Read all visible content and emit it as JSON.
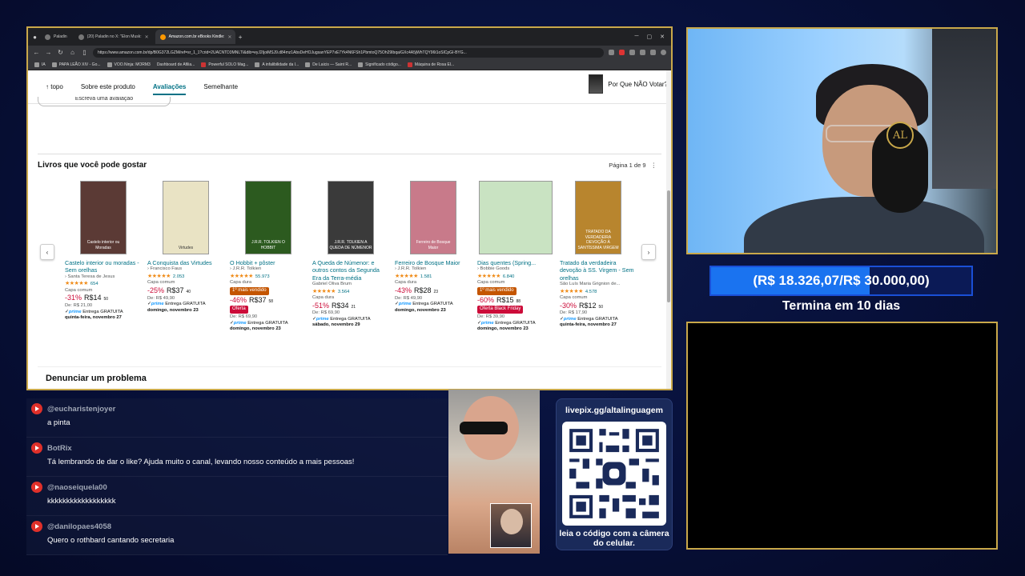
{
  "browser": {
    "tabs": [
      {
        "label": "Paladin"
      },
      {
        "label": "(20) Paladin no X: \"Elon Musk:"
      },
      {
        "label": "Amazon.com.br eBooks Kindle:"
      }
    ],
    "url": "https://www.amazon.com.br/dp/B0G372LGZM/ref=sr_1_1?crid=2UACNTD3MNLTI&dib=eyJ2IjoiMSJ9.d84mz1AbsDeHOJugsanYEP7xE7Yk4N6FSh1PbmtoQ75Oh29Ibqa/GXc4A5jWhTQY96t1oSlCpGI-BYG...",
    "bookmarks": [
      "IA",
      "PAPA LEÃO XIV - Go...",
      "VOO.Ninja: MORM3",
      "Dashboard de Afilia...",
      "Powerful SOLO Mag...",
      "A infalibilidade da I...",
      "De Laicis — Saint R...",
      "Significado código...",
      "Máquina de Rosa El..."
    ]
  },
  "subnav": {
    "top": "topo",
    "about": "Sobre este produto",
    "reviews": "Avaliações",
    "similar": "Semelhante",
    "mini_book": "Por Que NÃO Votar?"
  },
  "review_button": "Escreva uma avaliação",
  "recs": {
    "title": "Livros que você pode gostar",
    "page": "Página 1 de 9",
    "items": [
      {
        "title": "Castelo interior ou moradas - Sem orelhas",
        "author": "› Santa Teresa de Jesus",
        "stars": "★★★★★",
        "count": "654",
        "format": "Capa comum",
        "discount": "-31%",
        "price": "R$14",
        "cents": "50",
        "was": "De: R$ 21,00",
        "prime": "prime",
        "ship": "Entrega GRATUITA",
        "date": "quinta-feira, novembro 27",
        "cover_text": "Castelo interior ou Moradas",
        "cover": "#5b3a35"
      },
      {
        "title": "A Conquista das Virtudes",
        "author": "› Francisco Faus",
        "stars": "★★★★★",
        "count": "2.053",
        "format": "Capa comum",
        "discount": "-25%",
        "price": "R$37",
        "cents": "40",
        "was": "De: R$ 49,90",
        "prime": "prime",
        "ship": "Entrega GRATUITA",
        "date": "domingo, novembro 23",
        "cover_text": "Virtudes",
        "cover": "#e9e3c4"
      },
      {
        "title": "O Hobbit + pôster",
        "author": "› J.R.R. Tolkien",
        "stars": "★★★★★",
        "count": "55.973",
        "format": "Capa dura",
        "badge": "1º mais vendido",
        "discount": "-46%",
        "price": "R$37",
        "cents": "58",
        "badge2": "Oferta",
        "was": "De: R$ 69,90",
        "prime": "prime",
        "ship": "Entrega GRATUITA",
        "date": "domingo, novembro 23",
        "cover_text": "J.R.R. TOLKIEN O HOBBIT",
        "cover": "#2c5a1f"
      },
      {
        "title": "A Queda de Númenor: e outros contos da Segunda Era da Terra-média",
        "author": "Gabriel Oliva Brum",
        "stars": "★★★★★",
        "count": "3.564",
        "format": "Capa dura",
        "discount": "-51%",
        "price": "R$34",
        "cents": "21",
        "was": "De: R$ 69,90",
        "prime": "prime",
        "ship": "Entrega GRATUITA",
        "date": "sábado, novembro 29",
        "cover_text": "J.R.R. TOLKIEN A QUEDA DE NÚMENOR",
        "cover": "#3a3a3a"
      },
      {
        "title": "Ferreiro de Bosque Maior",
        "author": "› J.R.R. Tolkien",
        "stars": "★★★★★",
        "count": "1.581",
        "format": "Capa dura",
        "discount": "-43%",
        "price": "R$28",
        "cents": "23",
        "was": "De: R$ 49,90",
        "prime": "prime",
        "ship": "Entrega GRATUITA",
        "date": "domingo, novembro 23",
        "cover_text": "Ferreiro de Bosque Maior",
        "cover": "#c87a8a"
      },
      {
        "title": "Dias quentes (Spring...",
        "author": "› Bobbie Goods",
        "stars": "★★★★★",
        "count": "6.840",
        "format": "Capa comum",
        "badge": "1º mais vendido",
        "discount": "-60%",
        "price": "R$15",
        "cents": "88",
        "badge2": "Oferta Black Friday",
        "was": "De: R$ 39,90",
        "prime": "prime",
        "ship": "Entrega GRATUITA",
        "date": "domingo, novembro 23",
        "cover_text": "",
        "cover": "#c9e3c2"
      },
      {
        "title": "Tratado da verdadeira devoção à SS. Virgem - Sem orelhas",
        "author": "São Luís Maria Grignion de...",
        "stars": "★★★★★",
        "count": "4.578",
        "format": "Capa comum",
        "discount": "-30%",
        "price": "R$12",
        "cents": "50",
        "was": "De: R$ 17,90",
        "prime": "prime",
        "ship": "Entrega GRATUITA",
        "date": "quinta-feira, novembro 27",
        "cover_text": "TRATADO DA VERDADEIRA DEVOÇÃO À SANTÍSSIMA VIRGEM",
        "cover": "#b8852e"
      }
    ]
  },
  "report": "Denunciar um problema",
  "goal": {
    "text": "(R$ 18.326,07/R$ 30.000,00)",
    "progress": 0.61,
    "ends": "Termina em 10 dias"
  },
  "chat": [
    {
      "user": "@eucharistenjoyer",
      "text": "a pinta"
    },
    {
      "user": "BotRix",
      "text": "Tá lembrando de dar o like? Ajuda muito o canal, levando nosso conteúdo a mais pessoas!"
    },
    {
      "user": "@naoseiquela00",
      "text": "kkkkkkkkkkkkkkkkkk"
    },
    {
      "user": "@danilopaes4058",
      "text": "Quero o rothbard cantando secretaria"
    }
  ],
  "qr": {
    "url": "livepix.gg/altalinguagem",
    "hint": "leia o código com a câmera do celular."
  },
  "webcam": {
    "logo": "AL"
  },
  "colors": {
    "frame": "#c9a84a",
    "link": "#007185",
    "discount": "#cc0c39",
    "goal_fill": "#1a73f0"
  }
}
